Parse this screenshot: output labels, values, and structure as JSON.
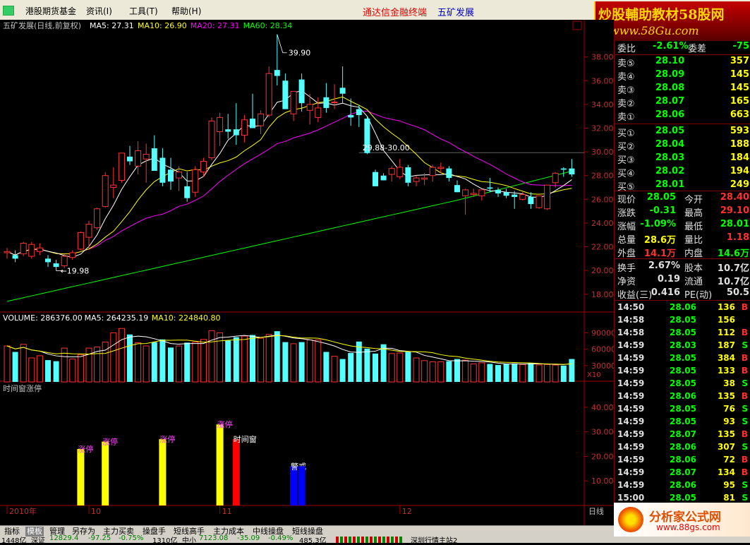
{
  "menu": {
    "items": [
      "港股期货基金",
      "资讯(I)",
      "工具(T)",
      "帮助(H)"
    ],
    "title_link": "通达信金融终端",
    "stock_name": "五矿发展"
  },
  "watermark_top": {
    "line1": "炒股輔助教材58股网",
    "line2": "www.58Gu.com"
  },
  "watermark_bottom": {
    "line1": "分析家公式网",
    "line2": "www.88gs.com"
  },
  "chart_data": [
    {
      "type": "candlestick",
      "title": "五矿发展(日线,前复权)",
      "indicators": [
        {
          "name": "MA5",
          "value": "27.31",
          "color": "#ffffff"
        },
        {
          "name": "MA10",
          "value": "26.90",
          "color": "#ffff00"
        },
        {
          "name": "MA20",
          "value": "27.31",
          "color": "#ff00ff"
        },
        {
          "name": "MA60",
          "value": "28.34",
          "color": "#00ff00"
        }
      ],
      "y_ticks": [
        "38.00",
        "36.00",
        "34.00",
        "32.00",
        "30.00",
        "28.00",
        "26.00",
        "24.00",
        "22.00",
        "20.00",
        "18.00"
      ],
      "ylim": [
        16.5,
        40.3
      ],
      "annotations": {
        "high_label": "39.90",
        "low_label": "19.98",
        "range_label": "29.88-30.00",
        "high": 39.9,
        "low": 19.98,
        "hline": 29.94
      },
      "candles": [
        [
          21.5,
          21.9,
          21.0,
          21.6
        ],
        [
          21.3,
          21.7,
          20.7,
          21.0
        ],
        [
          21.4,
          22.4,
          21.2,
          22.3
        ],
        [
          21.2,
          22.4,
          21.0,
          22.2
        ],
        [
          21.6,
          22.3,
          21.3,
          21.9
        ],
        [
          21.0,
          21.3,
          20.3,
          20.7
        ],
        [
          20.6,
          20.9,
          19.98,
          20.3
        ],
        [
          20.4,
          21.4,
          20.2,
          21.2
        ],
        [
          21.1,
          21.7,
          20.9,
          21.5
        ],
        [
          21.8,
          23.3,
          21.7,
          23.2
        ],
        [
          22.8,
          24.2,
          21.9,
          23.9
        ],
        [
          23.6,
          25.3,
          23.4,
          25.2
        ],
        [
          25.4,
          28.3,
          25.3,
          28.0
        ],
        [
          27.0,
          28.7,
          26.1,
          27.2
        ],
        [
          27.6,
          29.9,
          27.4,
          29.9
        ],
        [
          29.6,
          30.5,
          28.9,
          29.2
        ],
        [
          28.8,
          30.9,
          28.1,
          30.1
        ],
        [
          29.4,
          30.7,
          27.4,
          29.8
        ],
        [
          30.3,
          31.4,
          28.6,
          28.4
        ],
        [
          29.5,
          30.3,
          27.1,
          27.4
        ],
        [
          28.5,
          29.5,
          26.8,
          27.5
        ],
        [
          27.8,
          28.8,
          26.7,
          28.3
        ],
        [
          27.1,
          28.3,
          25.8,
          26.1
        ],
        [
          26.6,
          28.8,
          26.2,
          28.5
        ],
        [
          28.3,
          29.5,
          27.9,
          29.2
        ],
        [
          29.5,
          32.9,
          29.3,
          32.6
        ],
        [
          31.7,
          33.3,
          30.5,
          32.9
        ],
        [
          31.9,
          33.2,
          31.1,
          31.7
        ],
        [
          31.9,
          34.1,
          30.6,
          31.4
        ],
        [
          31.4,
          33.1,
          30.8,
          32.7
        ],
        [
          32.8,
          34.9,
          32.2,
          32.0
        ],
        [
          32.2,
          33.5,
          31.5,
          33.2
        ],
        [
          33.1,
          37.2,
          32.9,
          36.6
        ],
        [
          36.9,
          39.9,
          35.6,
          36.4
        ],
        [
          36.0,
          36.6,
          33.7,
          33.6
        ],
        [
          33.2,
          35.1,
          32.6,
          35.1
        ],
        [
          36.1,
          36.6,
          33.4,
          34.1
        ],
        [
          33.5,
          34.9,
          32.3,
          34.0
        ],
        [
          32.9,
          34.6,
          32.5,
          33.7
        ],
        [
          34.6,
          35.8,
          33.3,
          33.7
        ],
        [
          34.2,
          35.7,
          33.6,
          34.2
        ],
        [
          35.4,
          37.2,
          34.1,
          34.9
        ],
        [
          33.1,
          34.5,
          32.2,
          32.9
        ],
        [
          33.6,
          33.9,
          32.1,
          33.1
        ],
        [
          32.8,
          33.0,
          29.8,
          29.9
        ],
        [
          28.3,
          28.5,
          27.1,
          27.1
        ],
        [
          28.0,
          28.2,
          27.6,
          27.6
        ],
        [
          28.1,
          28.8,
          27.5,
          28.6
        ],
        [
          27.9,
          29.4,
          27.7,
          28.7
        ],
        [
          28.7,
          28.9,
          27.1,
          27.4
        ],
        [
          27.5,
          28.0,
          27.1,
          27.8
        ],
        [
          27.7,
          28.2,
          27.2,
          27.8
        ],
        [
          28.0,
          28.9,
          27.5,
          28.7
        ],
        [
          28.6,
          29.1,
          28.2,
          28.7
        ],
        [
          28.6,
          28.8,
          27.5,
          27.8
        ],
        [
          27.2,
          27.6,
          26.6,
          26.6
        ],
        [
          26.3,
          26.9,
          24.7,
          26.8
        ],
        [
          26.4,
          26.9,
          26.2,
          26.5
        ],
        [
          26.3,
          26.8,
          25.9,
          26.8
        ],
        [
          27.0,
          27.8,
          26.6,
          26.9
        ],
        [
          26.8,
          27.0,
          26.2,
          26.5
        ],
        [
          26.6,
          26.9,
          26.1,
          26.3
        ],
        [
          26.4,
          26.7,
          25.2,
          26.2
        ],
        [
          26.0,
          26.6,
          25.9,
          26.4
        ],
        [
          26.2,
          26.6,
          25.2,
          25.6
        ],
        [
          25.3,
          26.3,
          25.2,
          26.3
        ],
        [
          25.2,
          27.2,
          25.1,
          27.2
        ],
        [
          27.4,
          28.3,
          27.0,
          28.2
        ],
        [
          28.6,
          28.7,
          27.9,
          28.5
        ],
        [
          28.6,
          29.4,
          27.9,
          28.1
        ]
      ]
    },
    {
      "type": "bar",
      "title": "VOLUME",
      "indicators": [
        {
          "name": "VOLUME",
          "value": "286376.00",
          "color": "#ffffff"
        },
        {
          "name": "MA5",
          "value": "264235.19",
          "color": "#ffffff"
        },
        {
          "name": "MA10",
          "value": "224840.80",
          "color": "#ffff00"
        }
      ],
      "y_ticks": [
        "90000",
        "60000",
        "30000"
      ],
      "unit_label": "X10",
      "ylim": [
        0,
        110000
      ],
      "values": [
        66000,
        55000,
        69000,
        44000,
        48000,
        40000,
        38000,
        62000,
        42000,
        50000,
        62000,
        64000,
        73000,
        90000,
        98000,
        87000,
        72000,
        66000,
        73000,
        78000,
        63000,
        66000,
        72000,
        73000,
        78000,
        94000,
        90000,
        76000,
        82000,
        84000,
        86000,
        80000,
        87000,
        93000,
        73000,
        70000,
        73000,
        77000,
        77000,
        55000,
        47000,
        42000,
        53000,
        74000,
        61000,
        52000,
        69000,
        52000,
        53000,
        55000,
        44000,
        39000,
        37000,
        37000,
        38000,
        42000,
        40000,
        33000,
        35000,
        33000,
        31000,
        33000,
        34000,
        32000,
        35000,
        31000,
        32000,
        31000,
        30000,
        42000
      ]
    },
    {
      "type": "bar",
      "title": "时间窗涨停",
      "y_ticks": [
        "40.00",
        "30.00",
        "20.00",
        "10.00"
      ],
      "ylim": [
        0,
        46
      ],
      "bars": [
        {
          "x": 9,
          "value": 23,
          "label": "涨停",
          "color": "#ffff00"
        },
        {
          "x": 12,
          "value": 26,
          "label": "涨停",
          "color": "#ffff00"
        },
        {
          "x": 19,
          "value": 27,
          "label": "涨停",
          "color": "#ffff00"
        },
        {
          "x": 26,
          "value": 33,
          "label": "涨停",
          "color": "#ffff00"
        },
        {
          "x": 28,
          "value": 27,
          "label": "时间窗",
          "color": "#ff0000"
        },
        {
          "x": 35,
          "value": 16,
          "label": "警戒",
          "color": "#0000ff"
        },
        {
          "x": 36,
          "value": 16,
          "label": "",
          "color": "#0000ff"
        }
      ]
    }
  ],
  "x_axis": {
    "labels": [
      {
        "i": 0,
        "text": "2010年"
      },
      {
        "i": 10,
        "text": "10"
      },
      {
        "i": 26,
        "text": "11"
      },
      {
        "i": 48,
        "text": "12"
      }
    ],
    "period": "日线"
  },
  "panel": {
    "ratio": {
      "label": "委比",
      "value": "-2.61%",
      "diff_label": "委差",
      "diff": "-75"
    },
    "sells": [
      {
        "label": "卖⑤",
        "price": "28.10",
        "vol": "357"
      },
      {
        "label": "卖④",
        "price": "28.09",
        "vol": "145"
      },
      {
        "label": "卖③",
        "price": "28.08",
        "vol": "145"
      },
      {
        "label": "卖②",
        "price": "28.07",
        "vol": "165"
      },
      {
        "label": "卖①",
        "price": "28.06",
        "vol": "663"
      }
    ],
    "buys": [
      {
        "label": "买①",
        "price": "28.05",
        "vol": "593"
      },
      {
        "label": "买②",
        "price": "28.04",
        "vol": "188"
      },
      {
        "label": "买③",
        "price": "28.03",
        "vol": "184"
      },
      {
        "label": "买④",
        "price": "28.02",
        "vol": "194"
      },
      {
        "label": "买⑤",
        "price": "28.01",
        "vol": "249"
      }
    ],
    "quote": [
      {
        "l1": "现价",
        "v1": "28.05",
        "c1": "#00ff00",
        "l2": "今开",
        "v2": "28.40",
        "c2": "#ff3030"
      },
      {
        "l1": "涨跌",
        "v1": "-0.31",
        "c1": "#00ff00",
        "l2": "最高",
        "v2": "29.10",
        "c2": "#ff3030"
      },
      {
        "l1": "涨幅",
        "v1": "-1.09%",
        "c1": "#00ff00",
        "l2": "最低",
        "v2": "28.01",
        "c2": "#00ff00"
      },
      {
        "l1": "总量",
        "v1": "28.6万",
        "c1": "#ffff00",
        "l2": "量比",
        "v2": "1.18",
        "c2": "#ff3030"
      },
      {
        "l1": "外盘",
        "v1": "14.1万",
        "c1": "#ff3030",
        "l2": "内盘",
        "v2": "14.6万",
        "c2": "#00ff00"
      }
    ],
    "fund": [
      {
        "l1": "换手",
        "v1": "2.67%",
        "l2": "股本",
        "v2": "10.7亿"
      },
      {
        "l1": "净资",
        "v1": "0.19",
        "l2": "流通",
        "v2": "10.7亿"
      },
      {
        "l1": "收益(三)",
        "v1": "0.416",
        "l2": "PE(动)",
        "v2": "50.5"
      }
    ],
    "ticks": [
      [
        "14:50",
        "28.06",
        "136",
        "B"
      ],
      [
        "14:58",
        "28.05",
        "156",
        ""
      ],
      [
        "14:58",
        "28.05",
        "112",
        "B"
      ],
      [
        "14:59",
        "28.03",
        "187",
        "S"
      ],
      [
        "14:59",
        "28.05",
        "384",
        "B"
      ],
      [
        "14:59",
        "28.05",
        "133",
        "B"
      ],
      [
        "14:59",
        "28.05",
        "38",
        "S"
      ],
      [
        "14:59",
        "28.06",
        "135",
        "B"
      ],
      [
        "14:59",
        "28.05",
        "76",
        "S"
      ],
      [
        "14:59",
        "28.05",
        "93",
        "S"
      ],
      [
        "14:59",
        "28.07",
        "135",
        "B"
      ],
      [
        "14:59",
        "28.06",
        "307",
        "S"
      ],
      [
        "14:59",
        "28.06",
        "72",
        "B"
      ],
      [
        "14:59",
        "28.07",
        "134",
        "B"
      ],
      [
        "14:59",
        "28.06",
        "95",
        "S"
      ],
      [
        "15:00",
        "28.05",
        "81",
        "S"
      ]
    ]
  },
  "tabs": [
    "指标",
    "模板",
    "管理",
    "另存为",
    "主力买卖",
    "操盘手",
    "短线高手",
    "主力成本",
    "中线操盘",
    "短线操盘"
  ],
  "active_tab": "模板",
  "status": {
    "item1": "1448亿",
    "sz_label": "深证",
    "sz_value": "12829.4",
    "sz_change": "-97.25",
    "sz_pct": "-0.75%",
    "sz_amount": "1310亿",
    "zx_label": "中小",
    "zx_value": "7123.08",
    "zx_change": "-35.09",
    "zx_pct": "-0.49%",
    "zx_amount": "485.3亿",
    "server": "深圳行情主站2"
  }
}
